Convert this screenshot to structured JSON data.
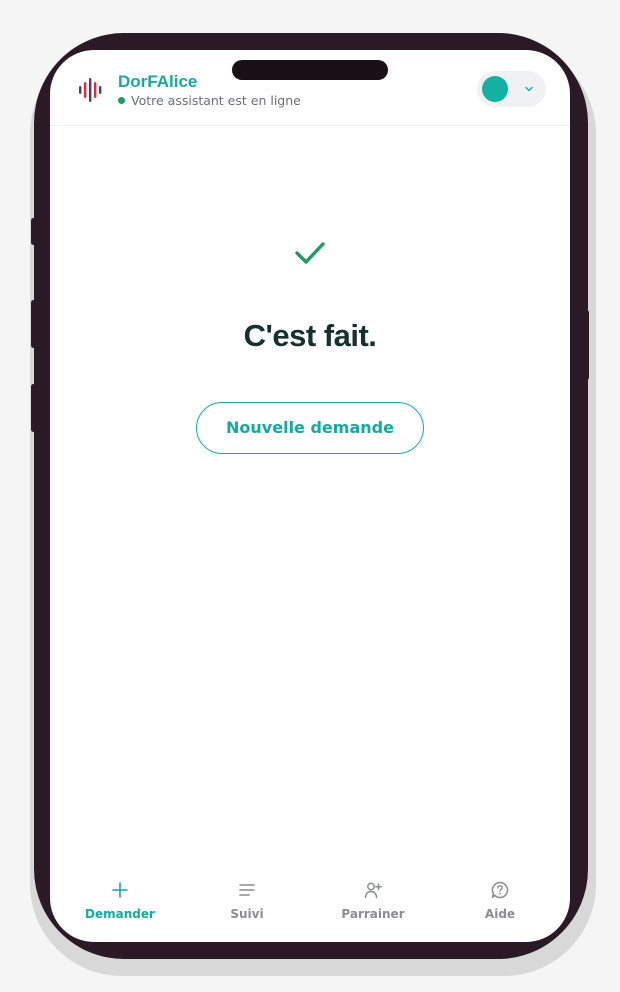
{
  "header": {
    "brand_name": "DorFAlice",
    "status_text": "Votre assistant est en ligne",
    "logo_icon": "soundwave-icon",
    "account_icon": "avatar-dot",
    "dropdown_icon": "chevron-down-icon"
  },
  "main": {
    "status_icon": "check-icon",
    "title": "C'est fait.",
    "new_request_label": "Nouvelle demande"
  },
  "bottom_nav": {
    "items": [
      {
        "label": "Demander",
        "icon": "plus-icon",
        "active": true
      },
      {
        "label": "Suivi",
        "icon": "list-icon",
        "active": false
      },
      {
        "label": "Parrainer",
        "icon": "user-plus-icon",
        "active": false
      },
      {
        "label": "Aide",
        "icon": "help-bubble-icon",
        "active": false
      }
    ]
  },
  "colors": {
    "accent": "#14aa9e",
    "success": "#1e9a64",
    "title": "#17302e",
    "inactive": "#8a8d90",
    "logo_red": "#d62f3a",
    "logo_purple": "#5b3a66"
  }
}
